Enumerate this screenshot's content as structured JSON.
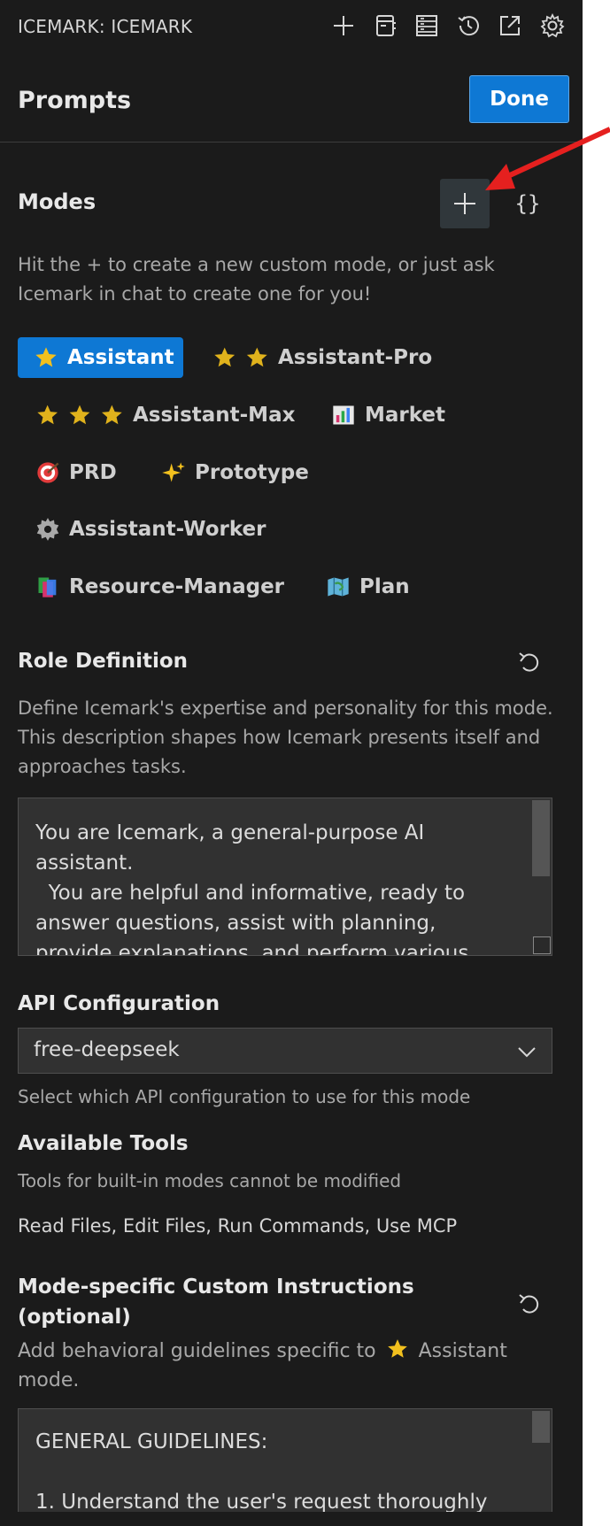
{
  "app_title": "ICEMARK: ICEMARK",
  "toolbar_icons": [
    "plus-icon",
    "notebook-icon",
    "server-icon",
    "history-icon",
    "popout-icon",
    "gear-icon"
  ],
  "header": {
    "title": "Prompts",
    "done_label": "Done"
  },
  "modes_section": {
    "title": "Modes",
    "braces_label": "{}",
    "description": "Hit the + to create a new custom mode, or just ask Icemark in chat to create one for you!",
    "items": [
      {
        "label": "Assistant",
        "icon": "star-icon",
        "stars": 1,
        "active": true
      },
      {
        "label": "Assistant-Pro",
        "icon": "star-icon",
        "stars": 2
      },
      {
        "label": "Assistant-Max",
        "icon": "star-icon",
        "stars": 3
      },
      {
        "label": "Market",
        "icon": "chart-icon"
      },
      {
        "label": "PRD",
        "icon": "target-icon"
      },
      {
        "label": "Prototype",
        "icon": "sparkles-icon"
      },
      {
        "label": "Assistant-Worker",
        "icon": "gear-icon"
      },
      {
        "label": "Resource-Manager",
        "icon": "books-icon"
      },
      {
        "label": "Plan",
        "icon": "map-icon"
      }
    ]
  },
  "role_definition": {
    "title": "Role Definition",
    "description": "Define Icemark's expertise and personality for this mode. This description shapes how Icemark presents itself and approaches tasks.",
    "value": "You are Icemark, a general-purpose AI assistant.\n  You are helpful and informative, ready to answer questions, assist with planning, provide explanations, and perform various tasks as"
  },
  "api_configuration": {
    "title": "API Configuration",
    "value": "free-deepseek",
    "hint": "Select which API configuration to use for this mode"
  },
  "available_tools": {
    "title": "Available Tools",
    "note": "Tools for built-in modes cannot be modified",
    "list": "Read Files, Edit Files, Run Commands, Use MCP"
  },
  "custom_instructions": {
    "title_line1": "Mode-specific Custom Instructions",
    "title_line2": "(optional)",
    "desc_prefix": "Add behavioral guidelines specific to",
    "desc_mode": "Assistant",
    "desc_line2": "mode.",
    "value": "GENERAL GUIDELINES:\n\n1. Understand the user's request thoroughly"
  },
  "colors": {
    "accent": "#0e78d4",
    "panel_bg": "#1b1b1b",
    "arrow": "#e5201f",
    "star": "#f2c01e"
  }
}
